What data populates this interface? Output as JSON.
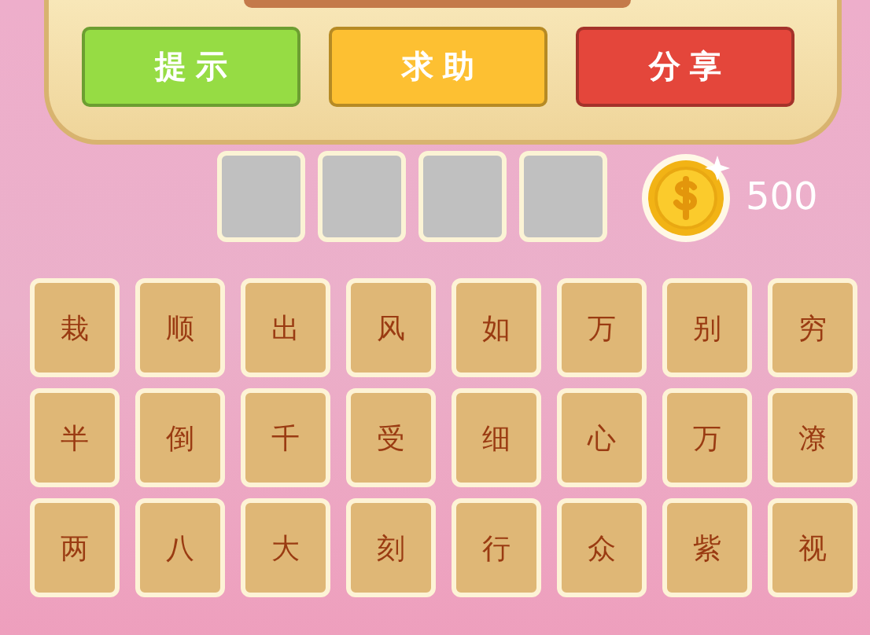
{
  "buttons": [
    {
      "label": "提示",
      "color": "#96dc44"
    },
    {
      "label": "求助",
      "color": "#fdc032"
    },
    {
      "label": "分享",
      "color": "#e4463b"
    }
  ],
  "answer_slots": [
    {
      "filled": false
    },
    {
      "filled": false
    },
    {
      "filled": false
    },
    {
      "filled": false
    }
  ],
  "coins": "500",
  "tiles": [
    [
      "栽",
      "顺",
      "出",
      "风",
      "如",
      "万",
      "别",
      "穷"
    ],
    [
      "半",
      "倒",
      "千",
      "受",
      "细",
      "心",
      "万",
      "潦"
    ],
    [
      "两",
      "八",
      "大",
      "刻",
      "行",
      "众",
      "紫",
      "视"
    ]
  ]
}
